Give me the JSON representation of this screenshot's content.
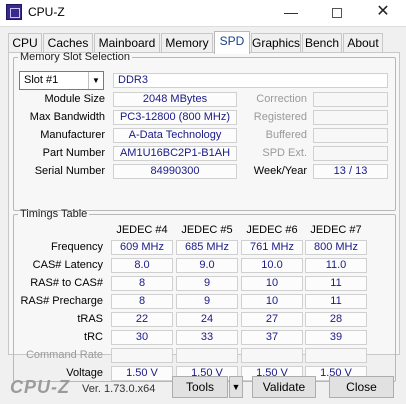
{
  "window": {
    "title": "CPU-Z",
    "minimize_glyph": "—",
    "close_glyph": "✕"
  },
  "tabs": [
    "CPU",
    "Caches",
    "Mainboard",
    "Memory",
    "SPD",
    "Graphics",
    "Bench",
    "About"
  ],
  "active_tab": "SPD",
  "slot_group": {
    "legend": "Memory Slot Selection",
    "selected_slot": "Slot #1",
    "memory_type": "DDR3",
    "fields": [
      {
        "label": "Module Size",
        "value": "2048 MBytes"
      },
      {
        "label": "Max Bandwidth",
        "value": "PC3-12800 (800 MHz)"
      },
      {
        "label": "Manufacturer",
        "value": "A-Data Technology"
      },
      {
        "label": "Part Number",
        "value": "AM1U16BC2P1-B1AH"
      },
      {
        "label": "Serial Number",
        "value": "84990300"
      }
    ],
    "right_fields": [
      {
        "label": "Correction",
        "value": ""
      },
      {
        "label": "Registered",
        "value": ""
      },
      {
        "label": "Buffered",
        "value": ""
      },
      {
        "label": "SPD Ext.",
        "value": ""
      }
    ],
    "week_year_label": "Week/Year",
    "week_year_value": "13 / 13"
  },
  "timings": {
    "legend": "Timings Table",
    "columns": [
      "JEDEC #4",
      "JEDEC #5",
      "JEDEC #6",
      "JEDEC #7"
    ],
    "rows": [
      {
        "label": "Frequency",
        "values": [
          "609 MHz",
          "685 MHz",
          "761 MHz",
          "800 MHz"
        ]
      },
      {
        "label": "CAS# Latency",
        "values": [
          "8.0",
          "9.0",
          "10.0",
          "11.0"
        ]
      },
      {
        "label": "RAS# to CAS#",
        "values": [
          "8",
          "9",
          "10",
          "11"
        ]
      },
      {
        "label": "RAS# Precharge",
        "values": [
          "8",
          "9",
          "10",
          "11"
        ]
      },
      {
        "label": "tRAS",
        "values": [
          "22",
          "24",
          "27",
          "28"
        ]
      },
      {
        "label": "tRC",
        "values": [
          "30",
          "33",
          "37",
          "39"
        ]
      },
      {
        "label": "Command Rate",
        "values": [
          "",
          "",
          "",
          ""
        ]
      },
      {
        "label": "Voltage",
        "values": [
          "1.50 V",
          "1.50 V",
          "1.50 V",
          "1.50 V"
        ]
      }
    ]
  },
  "footer": {
    "brand": "CPU-Z",
    "version": "Ver. 1.73.0.x64",
    "tools_label": "Tools",
    "validate_label": "Validate",
    "close_label": "Close"
  }
}
